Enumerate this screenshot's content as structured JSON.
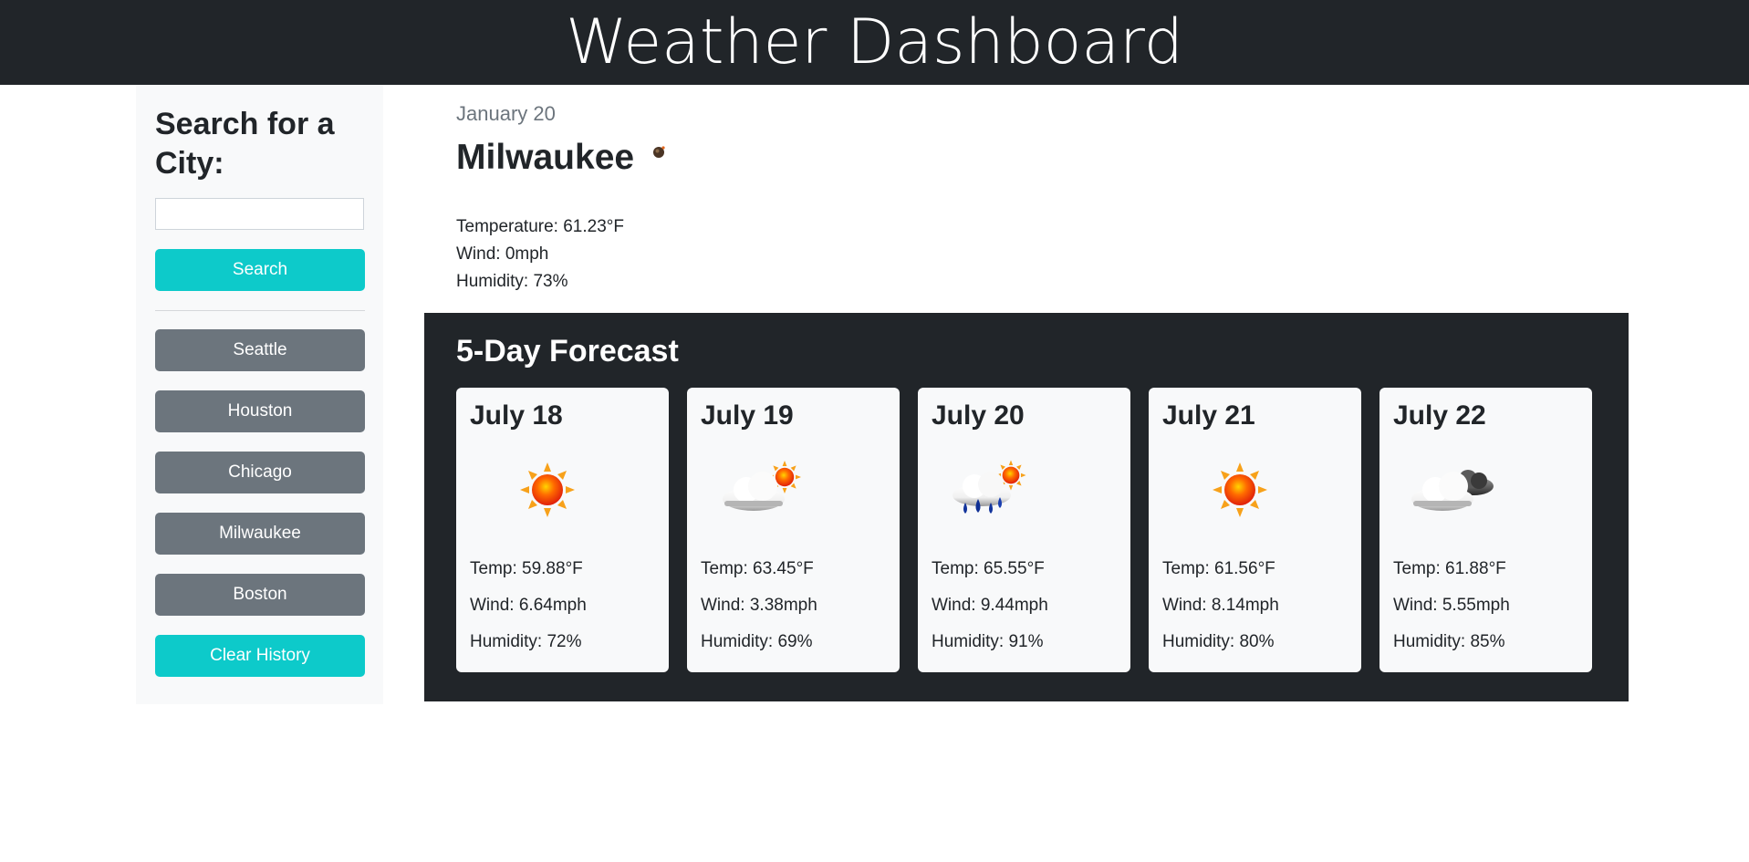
{
  "header": {
    "title": "Weather Dashboard"
  },
  "sidebar": {
    "heading": "Search for a City:",
    "search_input": {
      "value": "",
      "placeholder": ""
    },
    "search_label": "Search",
    "history": [
      "Seattle",
      "Houston",
      "Chicago",
      "Milwaukee",
      "Boston"
    ],
    "clear_label": "Clear History"
  },
  "current": {
    "date": "January 20",
    "city": "Milwaukee",
    "icon": "small-weather-icon",
    "temperature": "Temperature: 61.23°F",
    "wind": "Wind: 0mph",
    "humidity": "Humidity: 73%"
  },
  "forecast": {
    "heading": "5-Day Forecast",
    "days": [
      {
        "date": "July 18",
        "icon": "sun-icon",
        "temp": "Temp: 59.88°F",
        "wind": "Wind: 6.64mph",
        "humidity": "Humidity: 72%"
      },
      {
        "date": "July 19",
        "icon": "partly-cloudy-icon",
        "temp": "Temp: 63.45°F",
        "wind": "Wind: 3.38mph",
        "humidity": "Humidity: 69%"
      },
      {
        "date": "July 20",
        "icon": "rain-sun-icon",
        "temp": "Temp: 65.55°F",
        "wind": "Wind: 9.44mph",
        "humidity": "Humidity: 91%"
      },
      {
        "date": "July 21",
        "icon": "sun-icon",
        "temp": "Temp: 61.56°F",
        "wind": "Wind: 8.14mph",
        "humidity": "Humidity: 80%"
      },
      {
        "date": "July 22",
        "icon": "cloudy-icon",
        "temp": "Temp: 61.88°F",
        "wind": "Wind: 5.55mph",
        "humidity": "Humidity: 85%"
      }
    ]
  },
  "colors": {
    "header_bg": "#212529",
    "accent": "#0dcaca",
    "history_btn": "#6c757d",
    "sidebar_bg": "#f8f9fa"
  }
}
